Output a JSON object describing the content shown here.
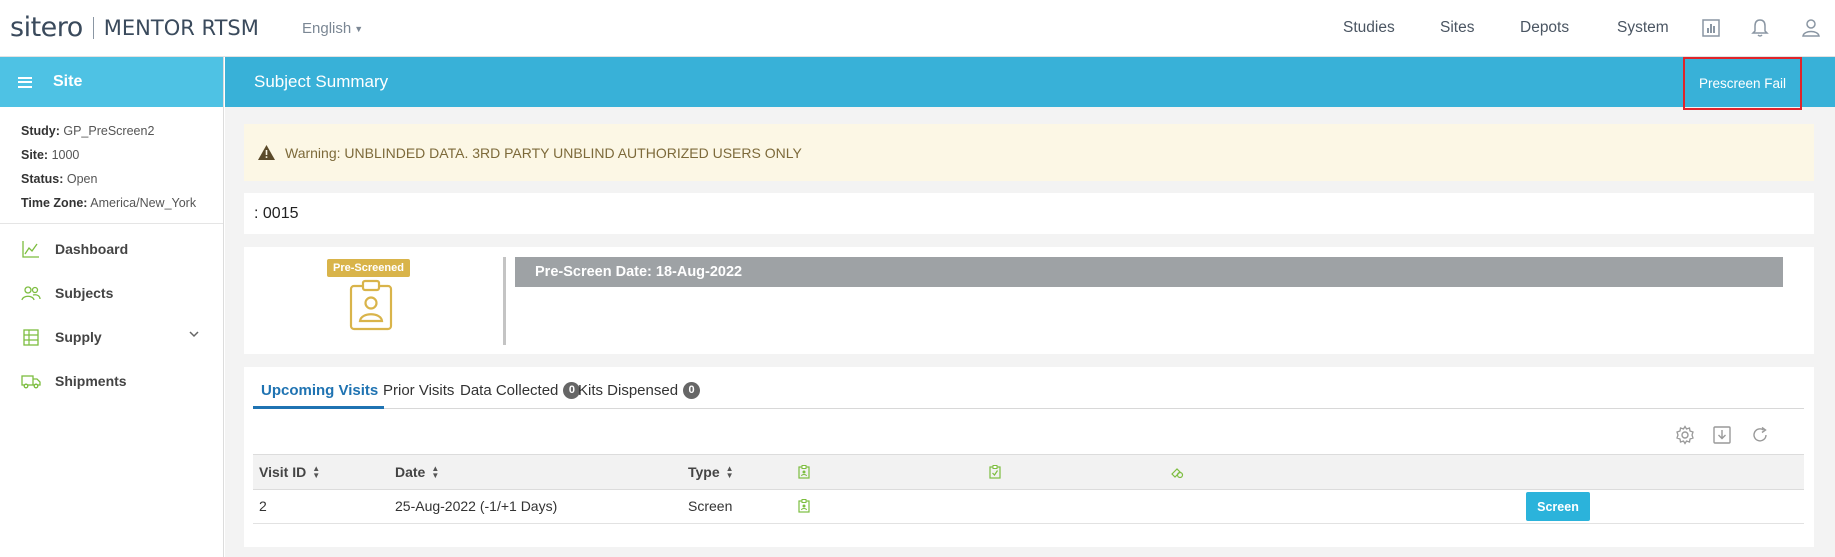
{
  "topbar": {
    "logo_brand": "sitero",
    "logo_product": "MENTOR RTSM",
    "language": "English",
    "nav": [
      "Studies",
      "Sites",
      "Depots",
      "System"
    ],
    "icons": [
      "report-icon",
      "bell-icon",
      "user-icon"
    ]
  },
  "sidebar": {
    "title": "Site",
    "info": [
      {
        "label": "Study:",
        "value": "GP_PreScreen2"
      },
      {
        "label": "Site:",
        "value": "1000"
      },
      {
        "label": "Status:",
        "value": "Open"
      },
      {
        "label": "Time Zone:",
        "value": "America/New_York"
      }
    ],
    "items": [
      {
        "label": "Dashboard",
        "icon": "chart-icon"
      },
      {
        "label": "Subjects",
        "icon": "people-icon"
      },
      {
        "label": "Supply",
        "icon": "supply-icon",
        "expandable": true
      },
      {
        "label": "Shipments",
        "icon": "truck-icon"
      }
    ]
  },
  "main": {
    "title": "Subject Summary",
    "action_button": "Prescreen Fail",
    "warning": "Warning: UNBLINDED DATA. 3RD PARTY UNBLIND AUTHORIZED USERS ONLY",
    "subject_id": ": 0015",
    "status_badge": "Pre-Screened",
    "prescreen_date": "Pre-Screen Date: 18-Aug-2022",
    "tabs": [
      {
        "label": "Upcoming Visits",
        "active": true
      },
      {
        "label": "Prior Visits"
      },
      {
        "label": "Data Collected",
        "count": "0"
      },
      {
        "label": "Kits Dispensed",
        "count": "0"
      }
    ],
    "table": {
      "columns": [
        "Visit ID",
        "Date",
        "Type"
      ],
      "rows": [
        {
          "visit_id": "2",
          "date": "25-Aug-2022 (-1/+1 Days)",
          "type": "Screen",
          "action": "Screen"
        }
      ]
    }
  },
  "colors": {
    "header_blue": "#38b1d8",
    "sidebar_head_blue": "#4ec2e4",
    "highlight_red": "#e0242a",
    "badge_gold": "#d9b44a",
    "accent_green": "#7cbd3f",
    "link_blue": "#1f73b2"
  }
}
